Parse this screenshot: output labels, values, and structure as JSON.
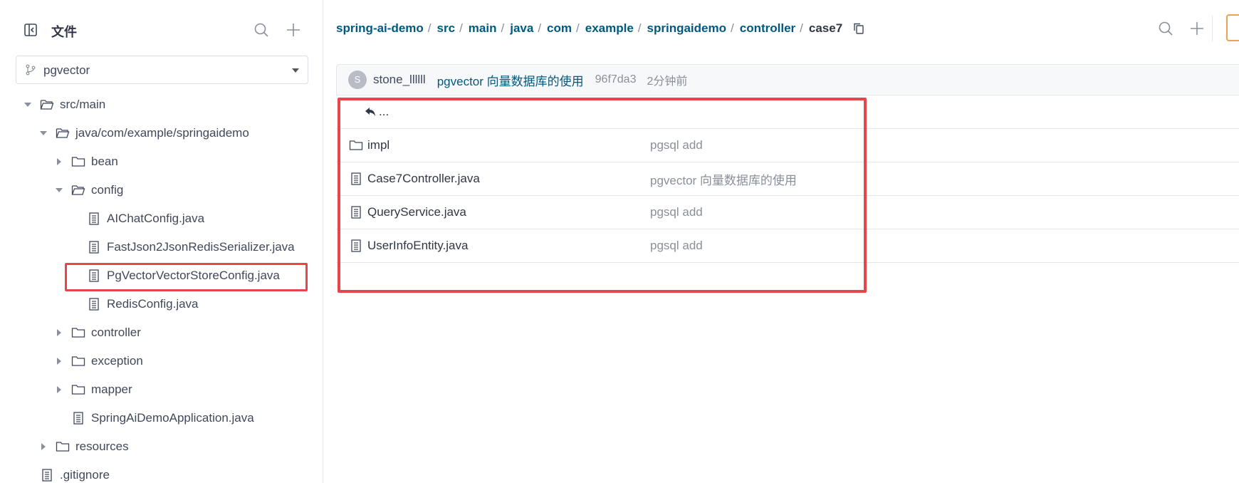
{
  "sidebar": {
    "title": "文件",
    "branch": "pgvector",
    "tree": [
      {
        "label": "src/main",
        "kind": "folder",
        "expanded": true
      },
      {
        "label": "java/com/example/springaidemo",
        "kind": "folder",
        "expanded": true
      },
      {
        "label": "bean",
        "kind": "folder",
        "expanded": false
      },
      {
        "label": "config",
        "kind": "folder",
        "expanded": true
      },
      {
        "label": "AIChatConfig.java",
        "kind": "file"
      },
      {
        "label": "FastJson2JsonRedisSerializer.java",
        "kind": "file"
      },
      {
        "label": "PgVectorVectorStoreConfig.java",
        "kind": "file",
        "highlighted": true
      },
      {
        "label": "RedisConfig.java",
        "kind": "file"
      },
      {
        "label": "controller",
        "kind": "folder",
        "expanded": false
      },
      {
        "label": "exception",
        "kind": "folder",
        "expanded": false
      },
      {
        "label": "mapper",
        "kind": "folder",
        "expanded": false
      },
      {
        "label": "SpringAiDemoApplication.java",
        "kind": "file"
      },
      {
        "label": "resources",
        "kind": "folder",
        "expanded": false
      },
      {
        "label": ".gitignore",
        "kind": "file"
      }
    ]
  },
  "breadcrumb": {
    "items": [
      "spring-ai-demo",
      "src",
      "main",
      "java",
      "com",
      "example",
      "springaidemo",
      "controller",
      "case7"
    ]
  },
  "commit": {
    "avatar_letter": "S",
    "author": "stone_llllll",
    "message": "pgvector 向量数据库的使用",
    "sha": "96f7da3",
    "time": "2分钟前"
  },
  "files": {
    "back_label": "...",
    "rows": [
      {
        "name": "impl",
        "kind": "folder",
        "message": "pgsql add"
      },
      {
        "name": "Case7Controller.java",
        "kind": "file",
        "message": "pgvector 向量数据库的使用"
      },
      {
        "name": "QueryService.java",
        "kind": "file",
        "message": "pgsql add"
      },
      {
        "name": "UserInfoEntity.java",
        "kind": "file",
        "message": "pgsql add"
      }
    ]
  },
  "colors": {
    "link": "#005980",
    "highlight": "#e8454a",
    "accent_button": "#f0a050"
  }
}
